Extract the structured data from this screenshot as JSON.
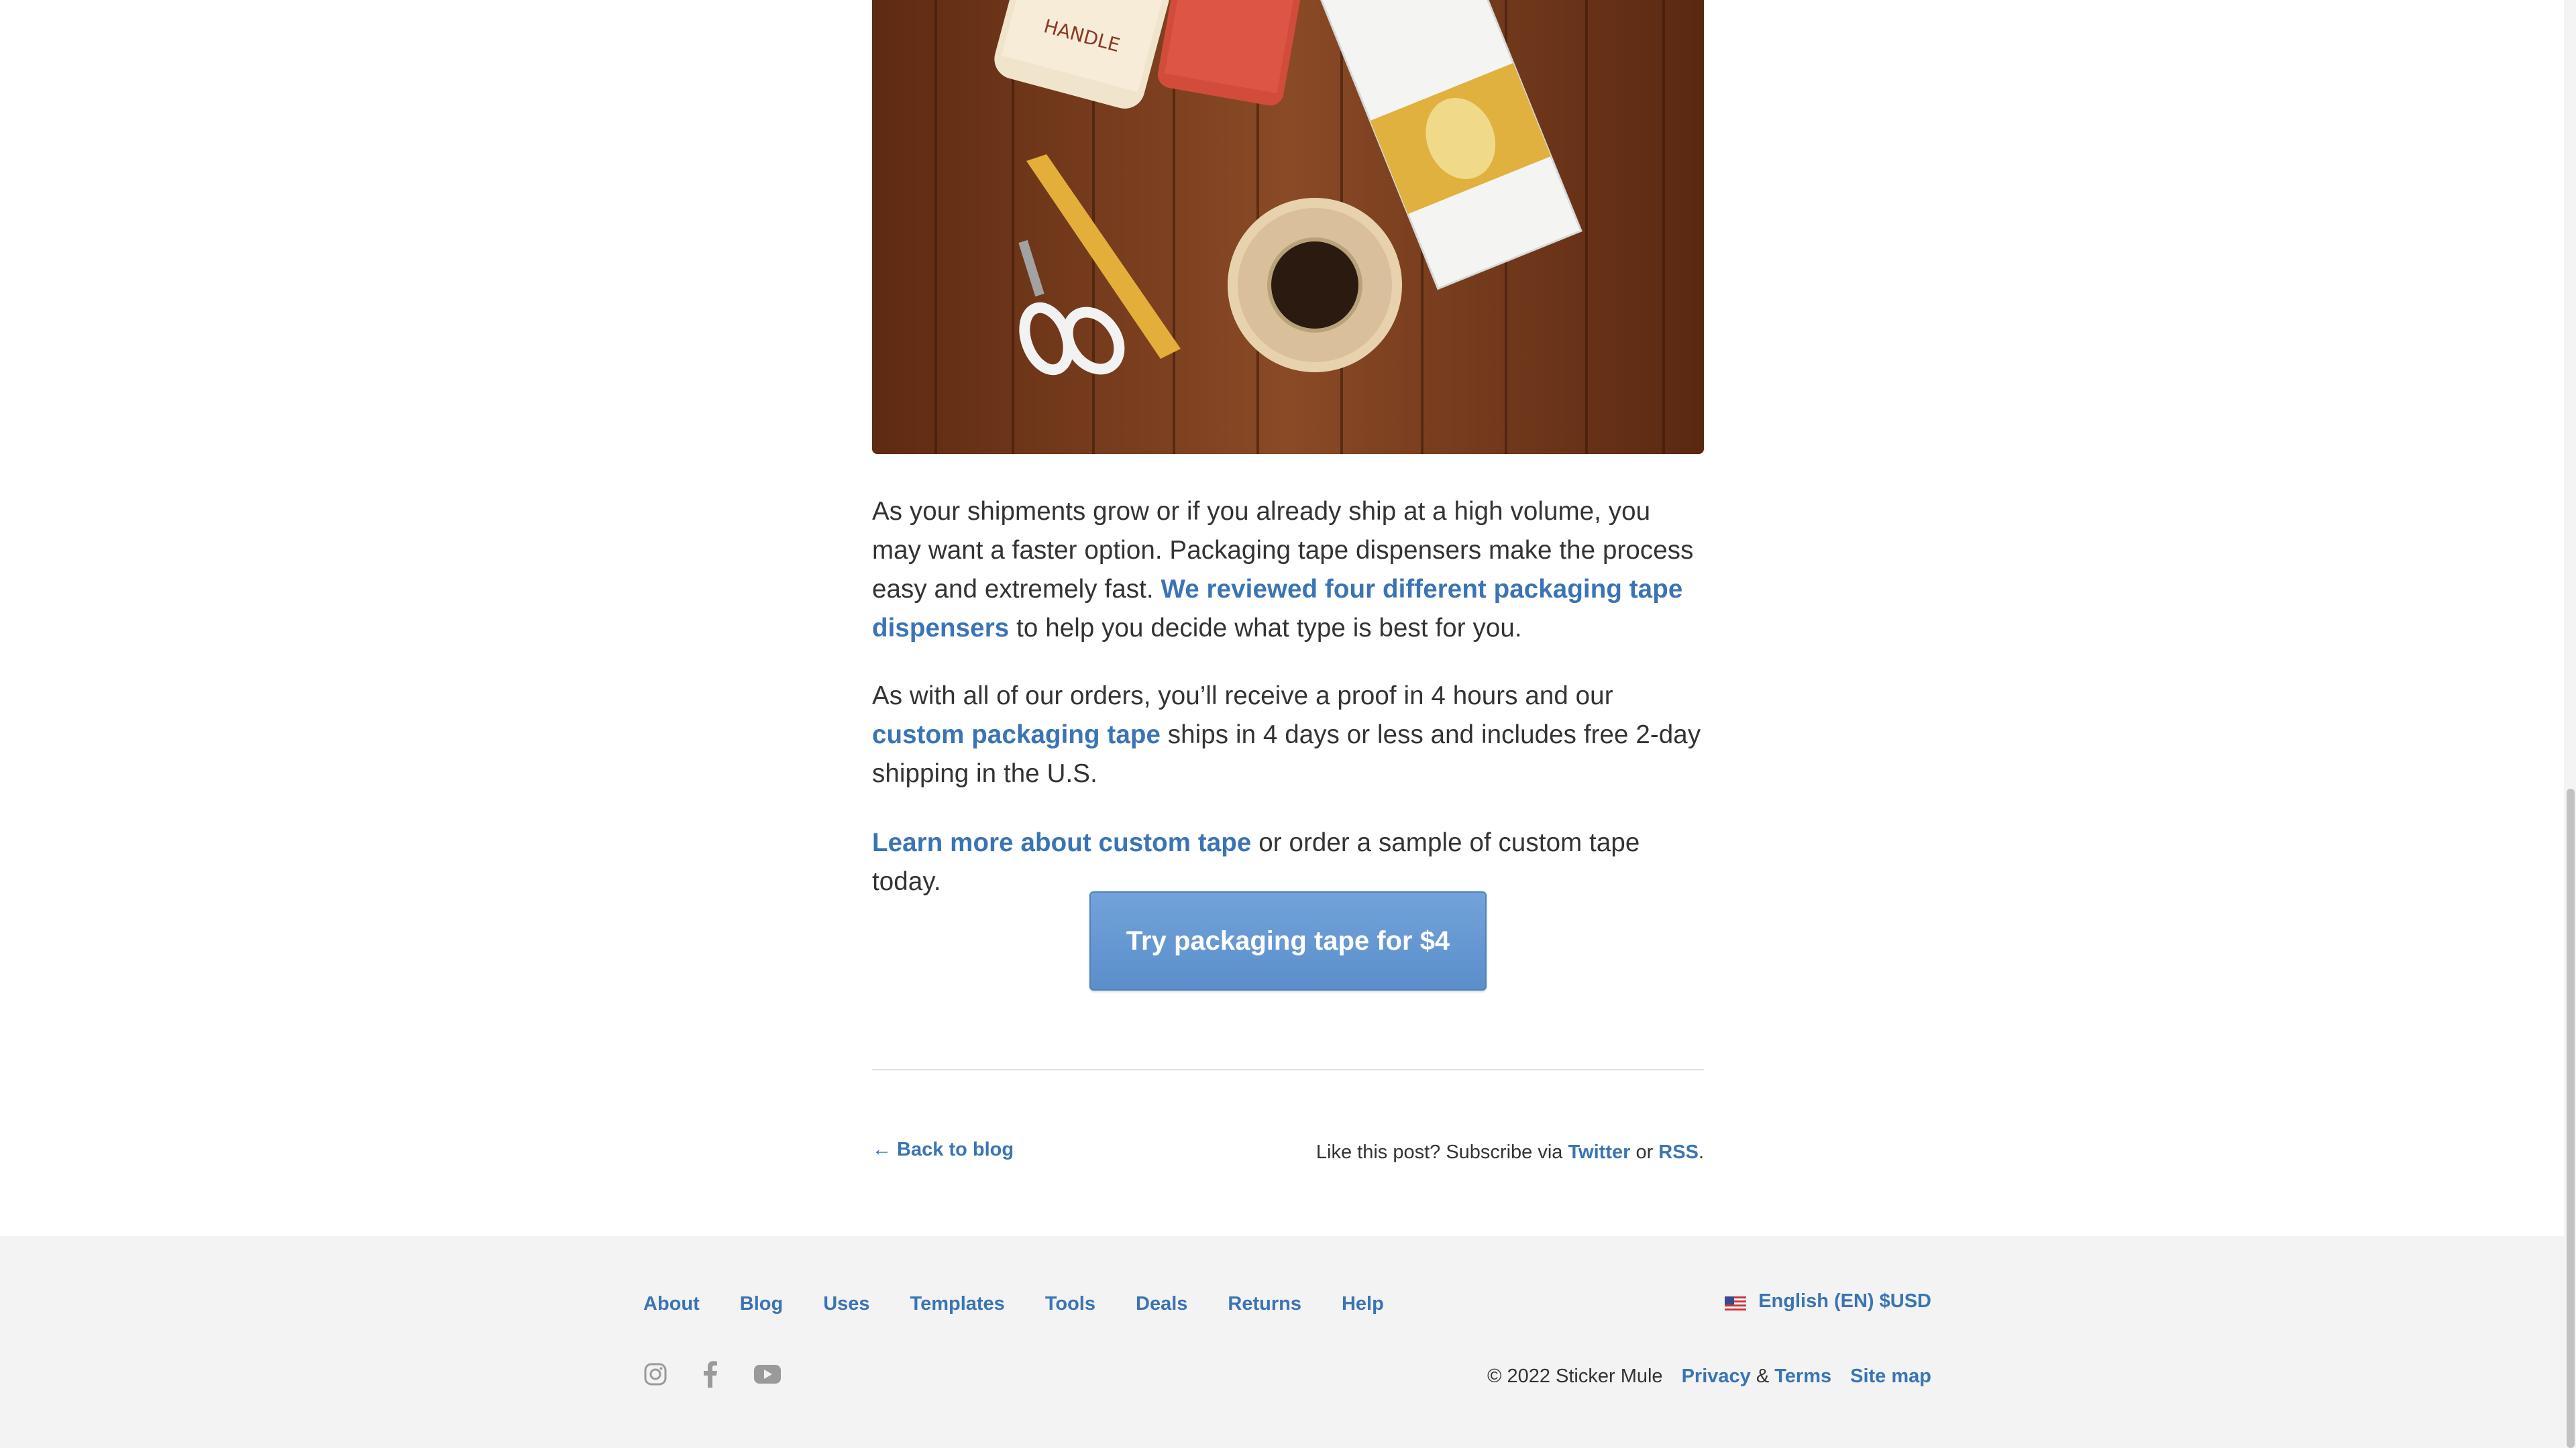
{
  "article": {
    "hero_image": "packaging tape, scissors and box on wooden table",
    "p1": {
      "text_before": "As your shipments grow or if you already ship at a high volume, you may want a faster option. Packaging tape dispensers make the process easy and extremely fast. ",
      "link": "We reviewed four different packaging tape dispensers",
      "text_after": " to help you decide what type is best for you."
    },
    "p2": {
      "text_before": "As with all of our orders, you’ll receive a proof in 4 hours and our ",
      "link": "custom packaging tape",
      "text_after": " ships in 4 days or less and includes free 2-day shipping in the U.S."
    },
    "p3": {
      "link": "Learn more about custom tape",
      "text_after": " or order a sample of custom tape today."
    },
    "cta_label": "Try packaging tape for $4",
    "back_label": "← Back to blog",
    "subscribe": {
      "text": "Like this post? Subscribe via ",
      "twitter": "Twitter",
      "or": " or ",
      "rss": "RSS",
      "end": "."
    }
  },
  "footer": {
    "nav": [
      "About",
      "Blog",
      "Uses",
      "Templates",
      "Tools",
      "Deals",
      "Returns",
      "Help"
    ],
    "language": "English (EN) $USD",
    "social_icons": [
      "instagram-icon",
      "facebook-icon",
      "youtube-icon"
    ],
    "copyright": "© 2022 Sticker Mule",
    "privacy": "Privacy",
    "amp": " & ",
    "terms": "Terms",
    "sitemap": "Site map"
  },
  "colors": {
    "link": "#3a74b5",
    "button": "#5a8fcb",
    "footer_bg": "#f3f3f3",
    "text": "#333333"
  }
}
